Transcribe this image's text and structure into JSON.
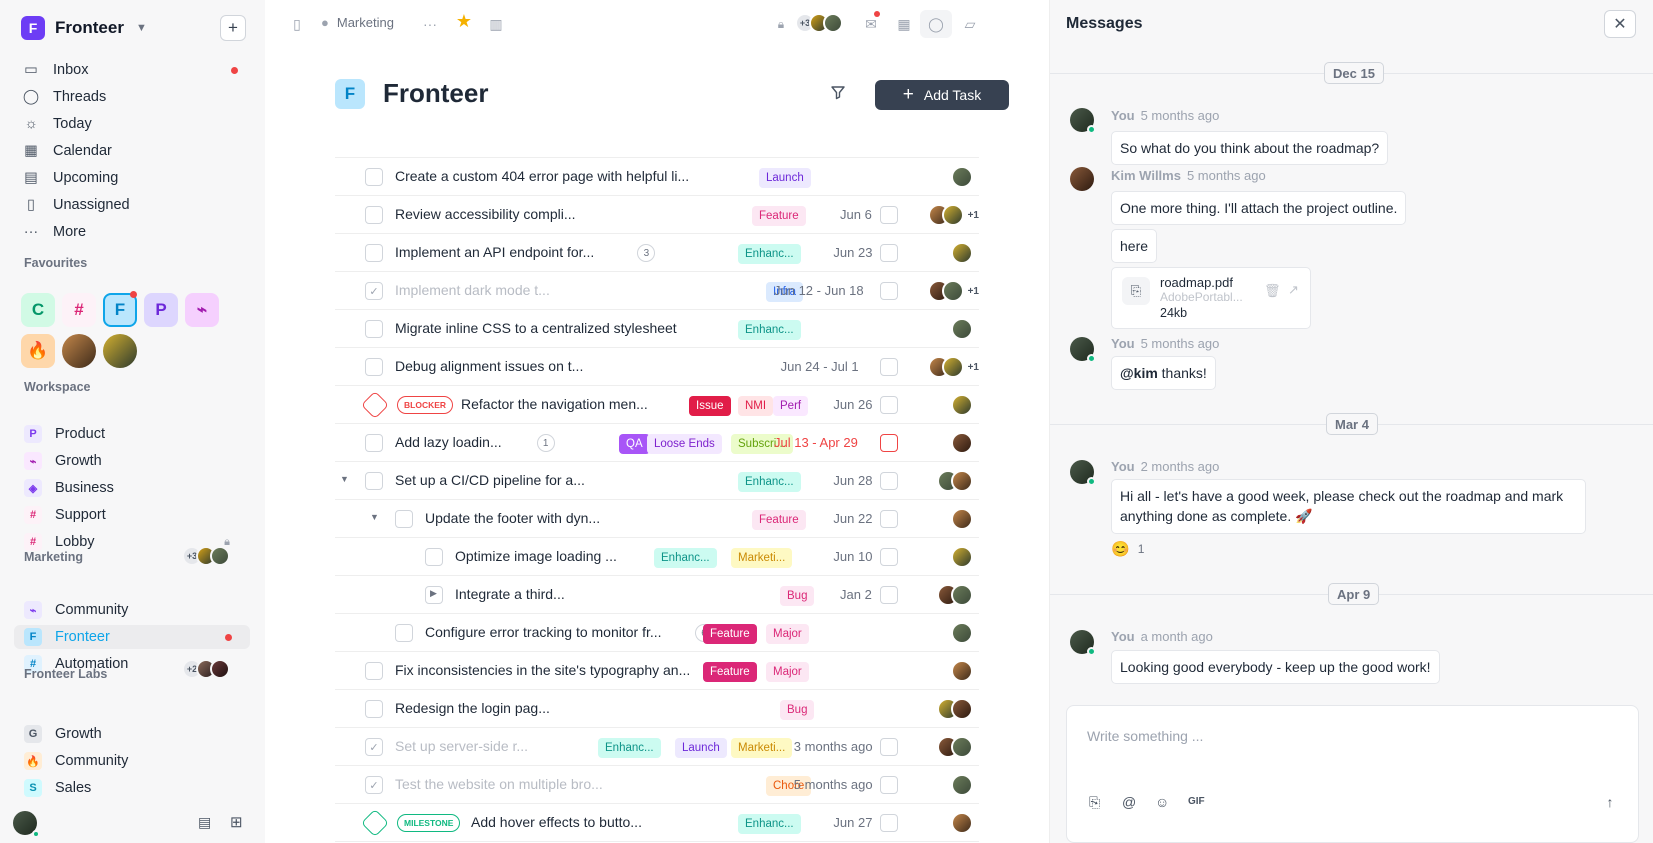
{
  "workspace": {
    "name": "Fronteer",
    "logo_letter": "F"
  },
  "nav": [
    {
      "label": "Inbox",
      "icon": "inbox-icon",
      "unread": true
    },
    {
      "label": "Threads",
      "icon": "threads-icon"
    },
    {
      "label": "Today",
      "icon": "sun-icon"
    },
    {
      "label": "Calendar",
      "icon": "calendar-icon"
    },
    {
      "label": "Upcoming",
      "icon": "upcoming-icon"
    },
    {
      "label": "Unassigned",
      "icon": "bookmark-icon"
    },
    {
      "label": "More",
      "icon": "more-icon"
    }
  ],
  "favourites": {
    "title": "Favourites",
    "items": [
      {
        "letter": "C",
        "bg": "#d1fae5",
        "fg": "#059669"
      },
      {
        "letter": "#",
        "bg": "#fdf2f8",
        "fg": "#db2777"
      },
      {
        "letter": "F",
        "bg": "#bae6fd",
        "fg": "#0284c7"
      },
      {
        "letter": "P",
        "bg": "#ddd6fe",
        "fg": "#6d28d9"
      },
      {
        "letter": "⌁",
        "bg": "#f5d0fe",
        "fg": "#a21caf"
      },
      {
        "letter": "🔥",
        "bg": "#fed7aa",
        "fg": "#ea580c"
      }
    ]
  },
  "workspace_section": {
    "title": "Workspace",
    "items": [
      {
        "label": "Product",
        "icon": "P",
        "bg": "#ede9fe",
        "fg": "#7c3aed"
      },
      {
        "label": "Growth",
        "icon": "⌁",
        "bg": "#fae8ff",
        "fg": "#a21caf"
      },
      {
        "label": "Business",
        "icon": "◈",
        "bg": "#ede9fe",
        "fg": "#7c3aed"
      },
      {
        "label": "Support",
        "icon": "#",
        "bg": "#fdf2f8",
        "fg": "#db2777"
      },
      {
        "label": "Lobby",
        "icon": "#",
        "bg": "#fdf2f8",
        "fg": "#db2777"
      }
    ]
  },
  "marketing_section": {
    "title": "Marketing",
    "count": "+3",
    "items": [
      {
        "label": "Community",
        "icon": "⌁",
        "bg": "#ede9fe",
        "fg": "#7c3aed"
      },
      {
        "label": "Fronteer",
        "icon": "F",
        "bg": "#bae6fd",
        "fg": "#0284c7"
      },
      {
        "label": "Automation",
        "icon": "#",
        "bg": "#e0f2fe",
        "fg": "#0284c7"
      }
    ]
  },
  "labs_section": {
    "title": "Fronteer Labs",
    "count": "+2",
    "items": [
      {
        "label": "Growth",
        "icon": "G",
        "bg": "#e5e7eb",
        "fg": "#4b5563"
      },
      {
        "label": "Community",
        "icon": "🔥",
        "bg": "#ffedd5",
        "fg": "#ea580c"
      },
      {
        "label": "Sales",
        "icon": "S",
        "bg": "#cffafe",
        "fg": "#0891b2"
      }
    ]
  },
  "topbar": {
    "breadcrumb": "Marketing",
    "avatars_count": "+3"
  },
  "project": {
    "letter": "F",
    "title": "Fronteer",
    "add_task_label": "Add Task"
  },
  "tasks": [
    {
      "title": "Create a custom 404 error page with helpful li...",
      "tags": [
        {
          "t": "Launch",
          "bg": "#ede9fe",
          "fg": "#6d28d9"
        }
      ],
      "date": "",
      "avatars": 1
    },
    {
      "title": "Review accessibility compli...",
      "tags": [
        {
          "t": "Feature",
          "bg": "#fce7f3",
          "fg": "#db2777"
        }
      ],
      "date": "Jun 6",
      "avatars": 2,
      "plus": "+1"
    },
    {
      "title": "Implement an API endpoint for...",
      "num": "3",
      "tags": [
        {
          "t": "Enhanc...",
          "bg": "#ccfbf1",
          "fg": "#0d9488"
        }
      ],
      "date": "Jun 23",
      "avatars": 1
    },
    {
      "title": "Implement dark mode t...",
      "faded": true,
      "tags": [
        {
          "t": "Infra",
          "bg": "#dbeafe",
          "fg": "#2563eb"
        }
      ],
      "date": "Jun 12 - Jun 18",
      "avatars": 2,
      "plus": "+1"
    },
    {
      "title": "Migrate inline CSS to a centralized stylesheet",
      "tags": [
        {
          "t": "Enhanc...",
          "bg": "#ccfbf1",
          "fg": "#0d9488"
        }
      ],
      "date": "",
      "avatars": 1
    },
    {
      "title": "Debug alignment issues on t...",
      "tags": [],
      "date": "Jun 24 - Jul 1",
      "avatars": 2,
      "plus": "+1"
    },
    {
      "title": "Refactor the navigation men...",
      "badge": "BLOCKER",
      "tags": [
        {
          "t": "Issue",
          "bg": "#e11d48",
          "fg": "#ffffff"
        },
        {
          "t": "NMI",
          "bg": "#ffe4e6",
          "fg": "#e11d48"
        },
        {
          "t": "Perf",
          "bg": "#fae8ff",
          "fg": "#a21caf"
        }
      ],
      "date": "Jun 26",
      "avatars": 1
    },
    {
      "title": "Add lazy loadin...",
      "num": "1",
      "tags": [
        {
          "t": "QA",
          "bg": "#a855f7",
          "fg": "#ffffff"
        },
        {
          "t": "Loose Ends",
          "bg": "#f3e8ff",
          "fg": "#7e22ce"
        },
        {
          "t": "Subscri...",
          "bg": "#ecfccb",
          "fg": "#65a30d"
        }
      ],
      "date": "Jul 13 - Apr 29",
      "date_red": true,
      "avatars": 1
    },
    {
      "title": "Set up a CI/CD pipeline for a...",
      "caret": true,
      "tags": [
        {
          "t": "Enhanc...",
          "bg": "#ccfbf1",
          "fg": "#0d9488"
        }
      ],
      "date": "Jun 28",
      "avatars": 2
    },
    {
      "title": "Update the footer with dyn...",
      "caret": true,
      "indent": 1,
      "tags": [
        {
          "t": "Feature",
          "bg": "#fce7f3",
          "fg": "#db2777"
        }
      ],
      "date": "Jun 22",
      "avatars": 1
    },
    {
      "title": "Optimize image loading ...",
      "indent": 2,
      "tags": [
        {
          "t": "Enhanc...",
          "bg": "#ccfbf1",
          "fg": "#0d9488"
        },
        {
          "t": "Marketi...",
          "bg": "#fef9c3",
          "fg": "#ca8a04"
        }
      ],
      "date": "Jun 10",
      "avatars": 1
    },
    {
      "title": "Integrate a third...",
      "indent": 2,
      "sub": "1",
      "tags": [
        {
          "t": "Bug",
          "bg": "#fce7f3",
          "fg": "#db2777"
        }
      ],
      "date": "Jan 2",
      "avatars": 2
    },
    {
      "title": "Configure error tracking to monitor fr...",
      "indent": 1,
      "num": "6",
      "tags": [
        {
          "t": "Feature",
          "bg": "#db2777",
          "fg": "#ffffff"
        },
        {
          "t": "Major",
          "bg": "#fce7f3",
          "fg": "#db2777"
        }
      ],
      "date": "",
      "avatars": 1
    },
    {
      "title": "Fix inconsistencies in the site's typography an...",
      "tags": [
        {
          "t": "Feature",
          "bg": "#db2777",
          "fg": "#ffffff"
        },
        {
          "t": "Major",
          "bg": "#fce7f3",
          "fg": "#db2777"
        }
      ],
      "date": "",
      "avatars": 1
    },
    {
      "title": "Redesign the login pag...",
      "tags": [
        {
          "t": "Bug",
          "bg": "#fce7f3",
          "fg": "#db2777"
        }
      ],
      "date": "",
      "avatars": 2
    },
    {
      "title": "Set up server-side r...",
      "faded": true,
      "tags": [
        {
          "t": "Enhanc...",
          "bg": "#ccfbf1",
          "fg": "#0d9488"
        },
        {
          "t": "Launch",
          "bg": "#ede9fe",
          "fg": "#6d28d9"
        },
        {
          "t": "Marketi...",
          "bg": "#fef9c3",
          "fg": "#ca8a04"
        }
      ],
      "date": "3 months ago",
      "avatars": 2
    },
    {
      "title": "Test the website on multiple bro...",
      "faded": true,
      "tags": [
        {
          "t": "Chore",
          "bg": "#ffedd5",
          "fg": "#ea580c"
        }
      ],
      "date": "5 months ago",
      "avatars": 1
    },
    {
      "title": "Add hover effects to butto...",
      "badge": "MILESTONE",
      "tags": [
        {
          "t": "Enhanc...",
          "bg": "#ccfbf1",
          "fg": "#0d9488"
        }
      ],
      "date": "Jun 27",
      "avatars": 1
    }
  ],
  "messages": {
    "title": "Messages",
    "dates": [
      "Dec 15",
      "Mar 4",
      "Apr 9"
    ],
    "items": [
      {
        "author": "You",
        "time": "5 months ago",
        "text": "So what do you think about the roadmap?"
      },
      {
        "author": "Kim Willms",
        "time": "5 months ago",
        "text": "One more thing. I'll attach the project outline.",
        "text2": "here"
      },
      {
        "author": "You",
        "time": "5 months ago",
        "mention": "@kim",
        "text": "thanks!"
      },
      {
        "author": "You",
        "time": "2 months ago",
        "text": "Hi all - let's have a good week, please check out the roadmap and mark anything done as complete. 🚀",
        "reaction": "😊",
        "reaction_count": "1"
      },
      {
        "author": "You",
        "time": "a month ago",
        "text": "Looking good everybody - keep up the good work!"
      }
    ],
    "file": {
      "name": "roadmap.pdf",
      "type": "AdobePortabl...",
      "size": "24kb"
    },
    "compose_placeholder": "Write something ...",
    "gif_label": "GIF"
  }
}
